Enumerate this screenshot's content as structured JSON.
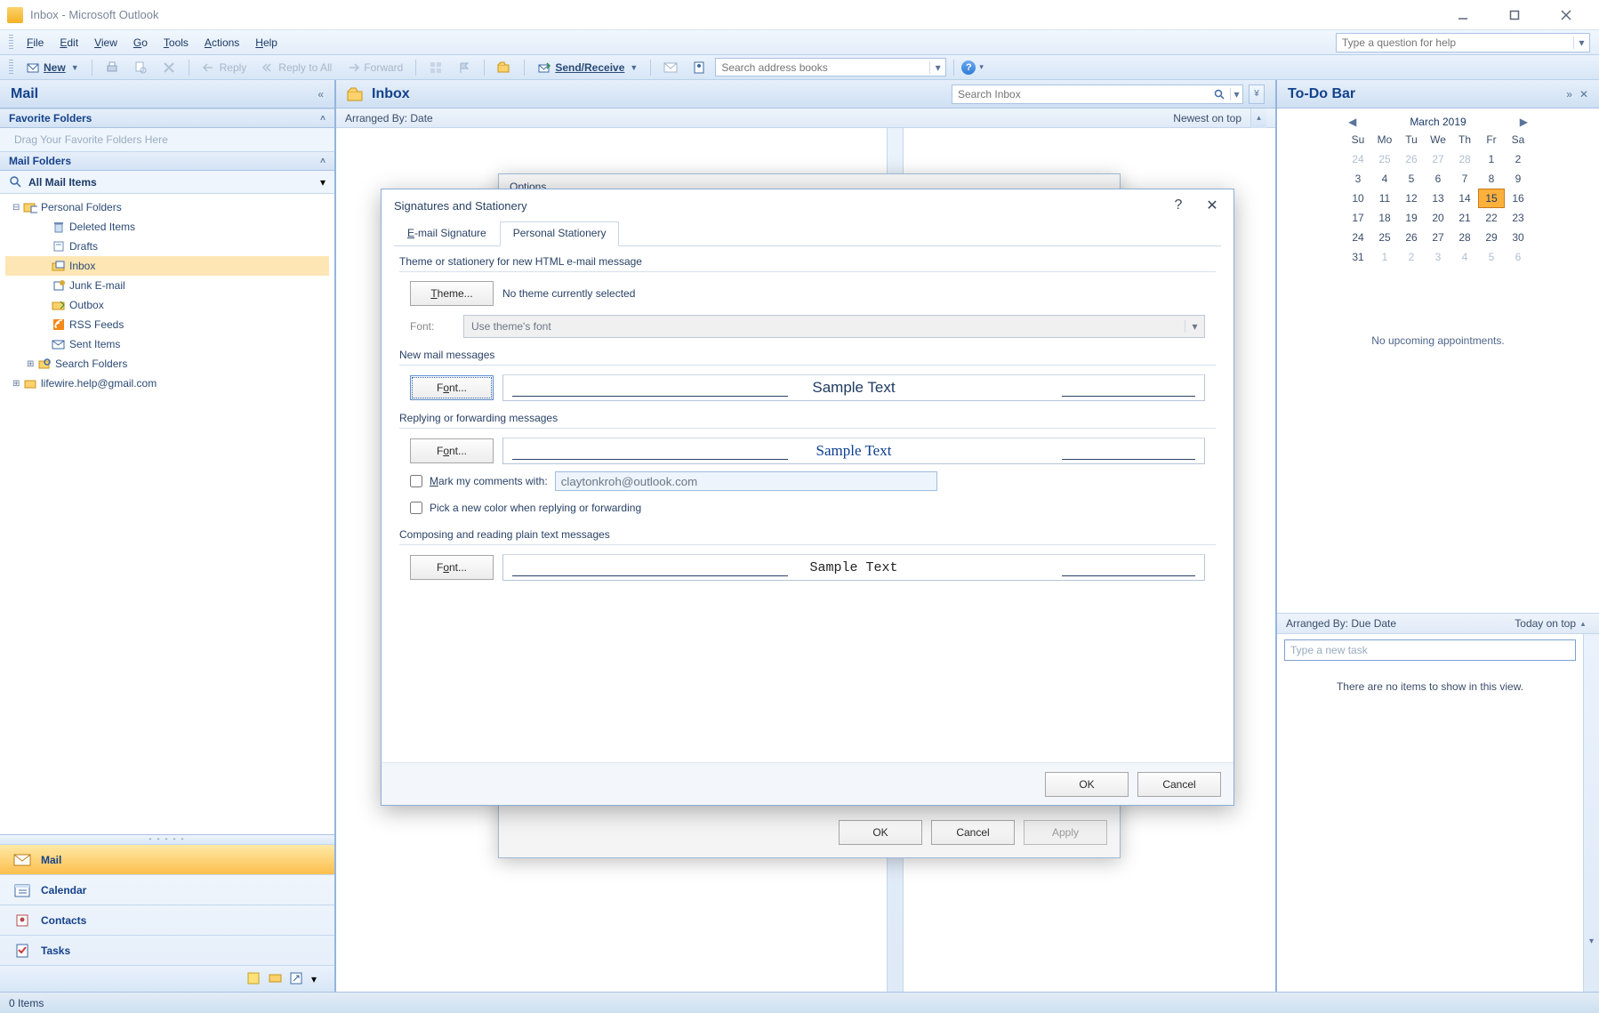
{
  "window": {
    "title": "Inbox - Microsoft Outlook"
  },
  "menus": [
    "File",
    "Edit",
    "View",
    "Go",
    "Tools",
    "Actions",
    "Help"
  ],
  "help_search_placeholder": "Type a question for help",
  "toolbar": {
    "new": "New",
    "reply": "Reply",
    "reply_all": "Reply to All",
    "forward": "Forward",
    "send_receive": "Send/Receive",
    "search_placeholder": "Search address books"
  },
  "mail": {
    "pane_title": "Mail",
    "favorite": "Favorite Folders",
    "favorite_drop": "Drag Your Favorite Folders Here",
    "mail_folders": "Mail Folders",
    "all_items": "All Mail Items",
    "tree": {
      "personal": "Personal Folders",
      "items": [
        "Deleted Items",
        "Drafts",
        "Inbox",
        "Junk E-mail",
        "Outbox",
        "RSS Feeds",
        "Sent Items",
        "Search Folders"
      ],
      "account": "lifewire.help@gmail.com"
    },
    "nav": {
      "mail": "Mail",
      "calendar": "Calendar",
      "contacts": "Contacts",
      "tasks": "Tasks"
    }
  },
  "inbox": {
    "title": "Inbox",
    "search_placeholder": "Search Inbox",
    "arranged_by": "Arranged By: Date",
    "newest": "Newest on top"
  },
  "todo": {
    "title": "To-Do Bar",
    "month": "March 2019",
    "dows": [
      "Su",
      "Mo",
      "Tu",
      "We",
      "Th",
      "Fr",
      "Sa"
    ],
    "prev_trail": [
      24,
      25,
      26,
      27,
      28
    ],
    "days": [
      1,
      2,
      3,
      4,
      5,
      6,
      7,
      8,
      9,
      10,
      11,
      12,
      13,
      14,
      15,
      16,
      17,
      18,
      19,
      20,
      21,
      22,
      23,
      24,
      25,
      26,
      27,
      28,
      29,
      30,
      31
    ],
    "next_lead": [
      1,
      2,
      3,
      4,
      5,
      6
    ],
    "today": 15,
    "no_appointments": "No upcoming appointments.",
    "task_arr": "Arranged By: Due Date",
    "task_right": "Today on top",
    "task_placeholder": "Type a new task",
    "no_items": "There are no items to show in this view."
  },
  "dialog_options": {
    "title": "Options",
    "ok": "OK",
    "cancel": "Cancel",
    "apply": "Apply"
  },
  "dialog": {
    "title": "Signatures and Stationery",
    "tabs": {
      "email": "E-mail Signature",
      "stationery": "Personal Stationery"
    },
    "sections": {
      "theme_label": "Theme or stationery for new HTML e-mail message",
      "theme_btn": "Theme...",
      "theme_note": "No theme currently selected",
      "font_label": "Font:",
      "font_placeholder": "Use theme's font",
      "new_mail": "New mail messages",
      "font_btn": "Font...",
      "sample": "Sample Text",
      "reply_section": "Replying or forwarding messages",
      "mark_comments": "Mark my comments with:",
      "mark_value": "claytonkroh@outlook.com",
      "pick_color": "Pick a new color when replying or forwarding",
      "plain_section": "Composing and reading plain text messages"
    },
    "ok": "OK",
    "cancel": "Cancel"
  },
  "status": "0 Items"
}
